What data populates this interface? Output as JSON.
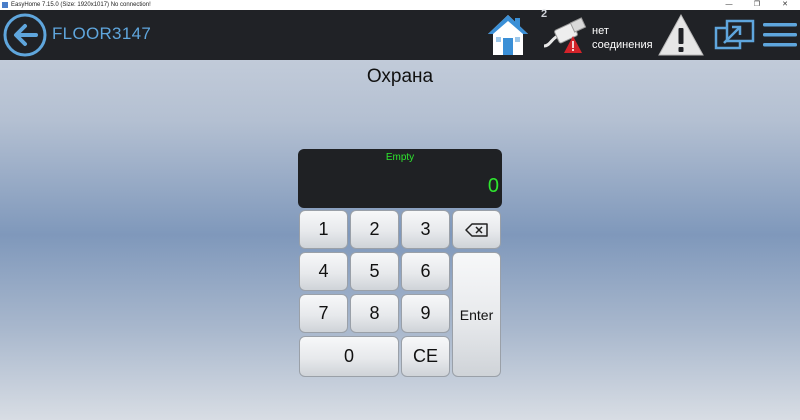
{
  "window": {
    "title": "EasyHome 7.15.0 (Size: 1920x1017) No connection!",
    "minimize": "—",
    "maximize": "❐",
    "close": "✕"
  },
  "header": {
    "site_name": "FLOOR3147",
    "network_badge": "2",
    "network_status_line1": "нет",
    "network_status_line2": "соединения"
  },
  "page": {
    "title": "Охрана"
  },
  "keypad": {
    "display_label": "Empty",
    "display_value": "0",
    "keys": {
      "k1": "1",
      "k2": "2",
      "k3": "3",
      "k4": "4",
      "k5": "5",
      "k6": "6",
      "k7": "7",
      "k8": "8",
      "k9": "9",
      "k0": "0",
      "ce": "CE",
      "enter": "Enter"
    }
  },
  "colors": {
    "header_bg": "#202226",
    "accent_blue": "#5fa6dd",
    "display_text": "#2ee52e",
    "alert_red": "#d3232a"
  }
}
